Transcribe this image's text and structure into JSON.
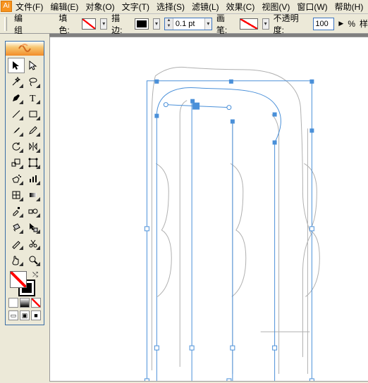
{
  "menu": {
    "file": "文件(F)",
    "edit": "编辑(E)",
    "object": "对象(O)",
    "type": "文字(T)",
    "select": "选择(S)",
    "filter": "滤镜(L)",
    "effect": "效果(C)",
    "view": "视图(V)",
    "window": "窗口(W)",
    "help": "帮助(H)"
  },
  "options": {
    "mode": "编组",
    "fill_label": "填色:",
    "stroke_label": "描边:",
    "stroke_weight": "0.1 pt",
    "brush_label": "画笔:",
    "opacity_label": "不透明度:",
    "opacity_value": "100",
    "opacity_suffix": "%",
    "style_label": "样"
  },
  "chart_data": null
}
